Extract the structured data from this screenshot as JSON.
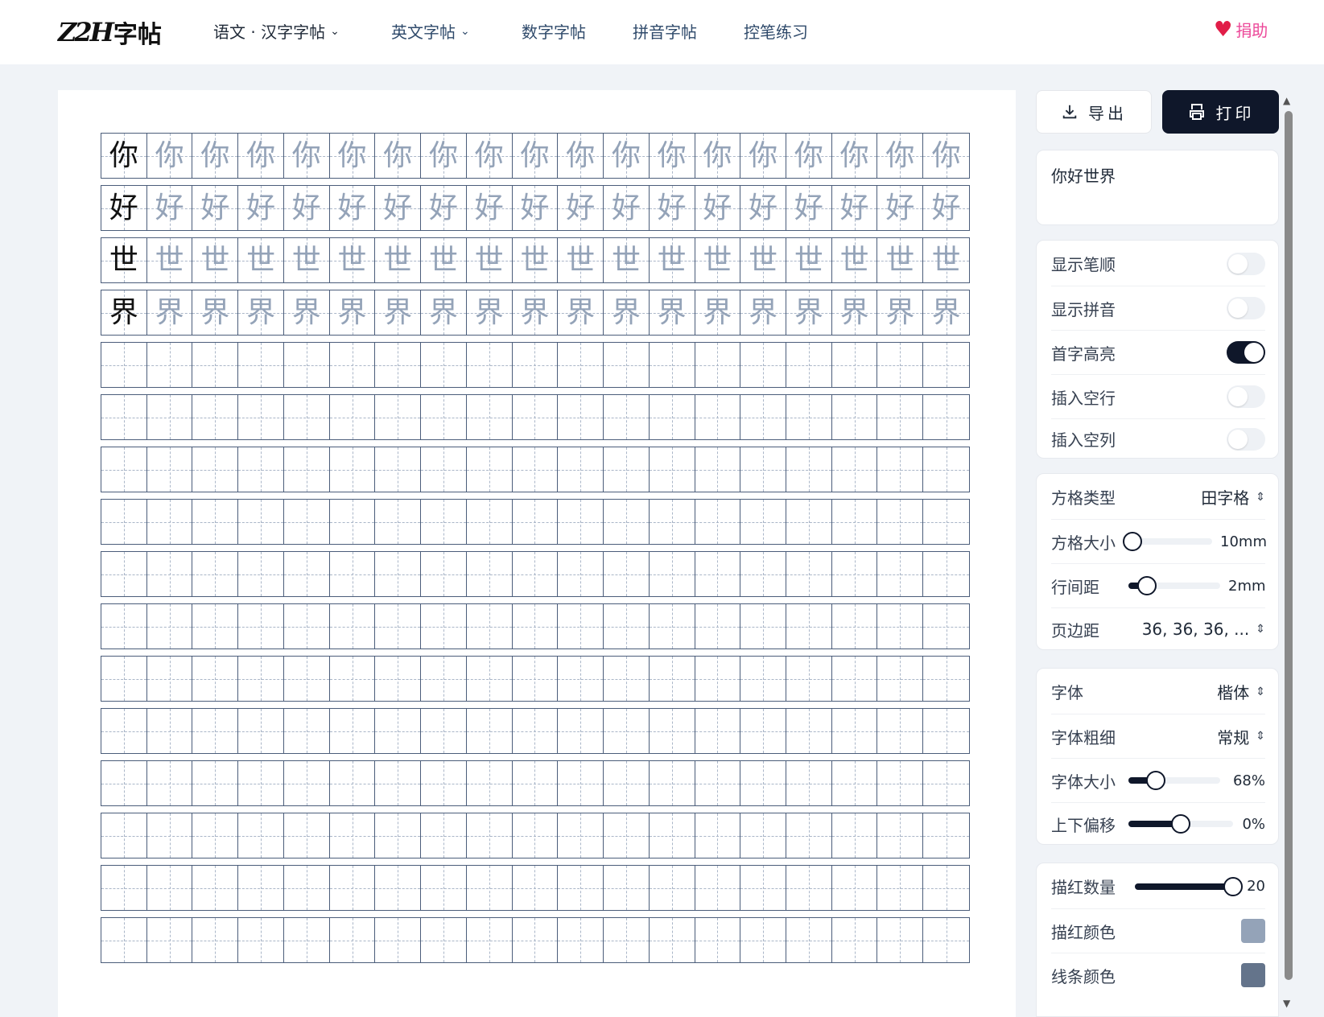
{
  "header": {
    "logo_latin": "Z2H",
    "logo_cjk": "字帖",
    "nav": [
      {
        "label": "语文 · 汉字字帖",
        "dropdown": true,
        "active": true
      },
      {
        "label": "英文字帖",
        "dropdown": true,
        "active": false
      },
      {
        "label": "数字字帖",
        "dropdown": false,
        "active": false
      },
      {
        "label": "拼音字帖",
        "dropdown": false,
        "active": false
      },
      {
        "label": "控笔练习",
        "dropdown": false,
        "active": false
      }
    ],
    "donate_label": "捐助"
  },
  "worksheet": {
    "characters": [
      "你",
      "好",
      "世",
      "界"
    ],
    "columns": 19,
    "total_rows": 16,
    "first_char_highlight": true
  },
  "sidebar": {
    "export_label": "导出",
    "print_label": "打印",
    "input_text": "你好世界",
    "toggles": [
      {
        "label": "显示笔顺",
        "on": false
      },
      {
        "label": "显示拼音",
        "on": false
      },
      {
        "label": "首字高亮",
        "on": true
      },
      {
        "label": "插入空行",
        "on": false
      },
      {
        "label": "插入空列",
        "on": false
      }
    ],
    "grid": {
      "type_label": "方格类型",
      "type_value": "田字格",
      "size_label": "方格大小",
      "size_value": "10mm",
      "size_level": 0.05,
      "spacing_label": "行间距",
      "spacing_value": "2mm",
      "spacing_level": 0.2,
      "margin_label": "页边距",
      "margin_value": "36, 36, 36, ..."
    },
    "font": {
      "font_label": "字体",
      "font_value": "楷体",
      "weight_label": "字体粗细",
      "weight_value": "常规",
      "size_label": "字体大小",
      "size_value": "68%",
      "size_level": 0.3,
      "offset_label": "上下偏移",
      "offset_value": "0%",
      "offset_level": 0.5
    },
    "trace": {
      "count_label": "描红数量",
      "count_value": "20",
      "count_level": 1.0,
      "color_label": "描红颜色",
      "color_value": "#94a3b8",
      "line_color_label": "线条颜色",
      "line_color_value": "#64748b"
    }
  }
}
